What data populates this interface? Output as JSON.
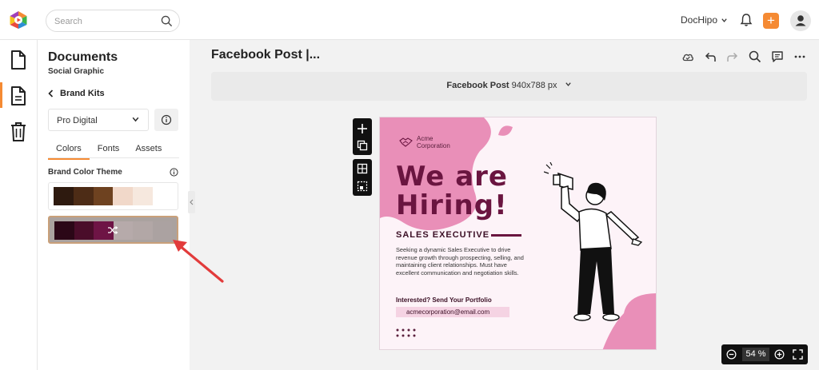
{
  "topbar": {
    "search_placeholder": "Search",
    "account_name": "DocHipo"
  },
  "panel": {
    "title": "Documents",
    "subtitle": "Social Graphic",
    "back_label": "Brand Kits",
    "kit_select": "Pro Digital",
    "tabs": [
      {
        "label": "Colors"
      },
      {
        "label": "Fonts"
      },
      {
        "label": "Assets"
      }
    ],
    "theme_label": "Brand Color Theme",
    "palettes": [
      [
        "#2e1a0f",
        "#4d2c16",
        "#6e4220",
        "#f1d8c9",
        "#f6e8de",
        "#ffffff"
      ],
      [
        "#2b0717",
        "#4a0d2a",
        "#6e1445",
        "#b6aaaa",
        "#b2a7a6",
        "#aba2a1"
      ]
    ]
  },
  "editor": {
    "doc_title": "Facebook Post |...",
    "size_name": "Facebook Post",
    "size_dims": "940x788 px",
    "zoom": "54 %"
  },
  "design": {
    "brand": "Acme Corporation",
    "headline_1": "We are",
    "headline_2": "Hiring!",
    "role": "SALES EXECUTIVE",
    "desc": "Seeking a dynamic Sales Executive to drive revenue growth through prospecting, selling, and maintaining client relationships. Must have excellent communication and negotiation skills.",
    "interested": "Interested? Send Your Portfolio",
    "email": "acmecorporation@email.com"
  },
  "colors": {
    "accent": "#f58a33",
    "brand_dark": "#6a1540",
    "pink": "#e98fb8"
  }
}
